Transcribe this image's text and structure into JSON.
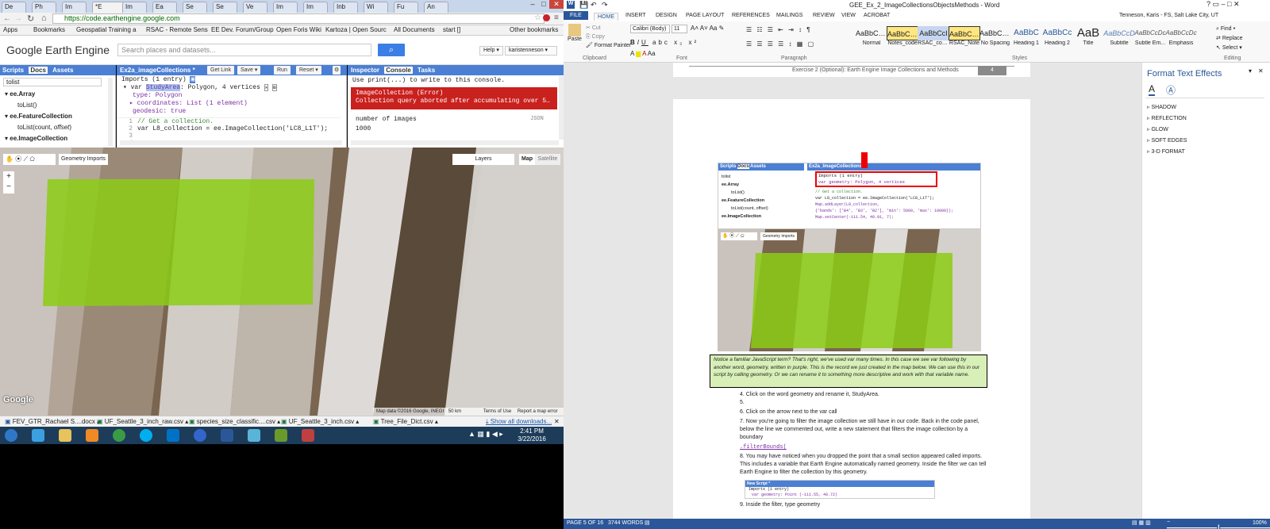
{
  "browser": {
    "tabs": [
      "De",
      "Ph",
      "Im",
      "*E",
      "Im",
      "Ea",
      "Se",
      "Se",
      "Ve",
      "Im",
      "Im",
      "Inb",
      "Wi",
      "Fu",
      "An"
    ],
    "active_tab_label": "*E",
    "url": "https://code.earthengine.google.com",
    "bookmarks": [
      "Apps",
      "Bookmarks",
      "Geospatial Training a",
      "RSAC - Remote Sens",
      "EE Dev. Forum/Group",
      "Open Foris Wiki",
      "Kartoza | Open Sourc",
      "All Documents",
      "start []",
      "Other bookmarks"
    ]
  },
  "ee": {
    "logo": "Google Earth Engine",
    "search_placeholder": "Search places and datasets...",
    "help": "Help",
    "user": "karistenneson",
    "left_tabs": [
      "Scripts",
      "Docs",
      "Assets"
    ],
    "docs_search": "tolist",
    "docs_items": [
      {
        "text": "ee.Array",
        "bold": true
      },
      {
        "text": "toList()",
        "bold": false
      },
      {
        "text": "ee.FeatureCollection",
        "bold": true
      },
      {
        "text": "toList(count, offset)",
        "bold": false
      },
      {
        "text": "ee.ImageCollection",
        "bold": true
      }
    ],
    "script_title": "Ex2a_imageCollections *",
    "get_link": "Get Link",
    "save": "Save",
    "run": "Run",
    "reset": "Reset",
    "imports_header": "Imports (1 entry)",
    "var_line": {
      "kw": "var",
      "name": "StudyArea",
      "rest": ": Polygon, 4 vertices"
    },
    "type_line": "type: Polygon",
    "coords_line": "coordinates: List (1 element)",
    "geodesic_line": "geodesic: true",
    "code_lines": [
      {
        "n": "1",
        "text": "// Get a collection."
      },
      {
        "n": "2",
        "text": "var L8_collection = ee.ImageCollection('LC8_L1T');"
      },
      {
        "n": "3",
        "text": ""
      },
      {
        "n": "4",
        "text": ""
      }
    ],
    "right_tabs": [
      "Inspector",
      "Console",
      "Tasks"
    ],
    "console_hint": "Use print(...) to write to this console.",
    "error_title": "ImageCollection (Error)",
    "error_msg": "Collection query aborted after accumulating over 5000 el",
    "num_images_label": "number of images",
    "num_images_value": "1000",
    "json_label": "JSON",
    "geometry_imports": "Geometry Imports",
    "layers": "Layers",
    "map_btn": "Map",
    "satellite_btn": "Satellite",
    "map_attrib": "Map data ©2016 Google, INEGI",
    "scale": "50 km",
    "terms": "Terms of Use",
    "report": "Report a map error"
  },
  "downloads": [
    "FEV_GTR_Rachael S....docx",
    "UF_Seattle_3_inch_raw.csv",
    "species_size_classific....csv",
    "UF_Seattle_3_inch.csv",
    "Tree_File_Dict.csv"
  ],
  "show_all": "Show all downloads...",
  "taskbar": {
    "time": "2:41 PM",
    "date": "3/22/2016"
  },
  "word": {
    "title": "GEE_Ex_2_ImageCollectionsObjectsMethods - Word",
    "tabs": [
      "FILE",
      "HOME",
      "INSERT",
      "DESIGN",
      "PAGE LAYOUT",
      "REFERENCES",
      "MAILINGS",
      "REVIEW",
      "VIEW",
      "ACROBAT"
    ],
    "user": "Tenneson, Karis - FS, Salt Lake City, UT",
    "clipboard": {
      "paste": "Paste",
      "cut": "Cut",
      "copy": "Copy",
      "format_painter": "Format Painter",
      "label": "Clipboard"
    },
    "font": {
      "name": "Calibri (Body)",
      "size": "11",
      "label": "Font"
    },
    "paragraph_label": "Paragraph",
    "styles_label": "Styles",
    "editing_label": "Editing",
    "styles": [
      {
        "preview": "AaBbCcDc",
        "name": "Normal"
      },
      {
        "preview": "AaBbCcD",
        "name": "Notes_code"
      },
      {
        "preview": "AaBbCcI",
        "name": "RSAC_con..."
      },
      {
        "preview": "AaBbCcD",
        "name": "RSAC_Note"
      },
      {
        "preview": "AaBbCcDc",
        "name": "No Spacing"
      },
      {
        "preview": "AaBbC",
        "name": "Heading 1"
      },
      {
        "preview": "AaBbCc",
        "name": "Heading 2"
      },
      {
        "preview": "AaB",
        "name": "Title"
      },
      {
        "preview": "AaBbCcD",
        "name": "Subtitle"
      },
      {
        "preview": "AaBbCcDc",
        "name": "Subtle Em..."
      },
      {
        "preview": "AaBbCcDc",
        "name": "Emphasis"
      }
    ],
    "editing": [
      "Find",
      "Replace",
      "Select"
    ],
    "footer_text": "Exercise 2 (Optional): Earth Engine Image Collections and Methods",
    "page_num": "4",
    "embedded": {
      "tabs": [
        "Scripts",
        "Docs",
        "Assets"
      ],
      "title": "Ex2a_ImageCollections *",
      "imports": "Imports (1 entry)",
      "var_geom": "var geometry: Polygon, 4 vertices",
      "code": [
        "// Get a collection.",
        "var L8_collection = ee.ImageCollection('LC8_L1T');",
        "",
        "Map.addLayer(L8_collection,",
        "  {'bands': ['B4', 'B3', 'B2'], 'min': 5000, 'max': 10000});",
        "Map.setCenter(-111.54, 40.91, 7);"
      ],
      "geometry_imports": "Geometry Imports",
      "docs": [
        "tolist",
        "ee.Array",
        "toList()",
        "ee.FeatureCollection",
        "toList(count, offset)",
        "ee.ImageCollection"
      ]
    },
    "note": "Notice a familiar JavaScript term? That's right, we've used var many times. In this case we see var following by another word, geometry, written in purple. This is the record we just created in the map below. We can use this in our script by calling geometry. Or we can rename it to something more descriptive and work with that variable name.",
    "list": [
      {
        "n": "4.",
        "text": "Click on the word geometry and rename it, StudyArea."
      },
      {
        "n": "5.",
        "text": ""
      },
      {
        "n": "6.",
        "text": "Click on the arrow next to the var call"
      },
      {
        "n": "7.",
        "text": "Now you're going to filter the image collection we still have in our code. Back in the code panel, below the line we commented out, write a new statement that filters the image collection by a boundary"
      },
      {
        "n": "",
        "text": ".filterBounds("
      },
      {
        "n": "8.",
        "text": "You may have noticed when you dropped the point that a small section appeared called imports. This includes a variable that Earth Engine automatically named geometry. Inside the filter we can tell Earth Engine to filter the collection by this geometry."
      },
      {
        "n": "9.",
        "text": "Inside the filter, type geometry"
      }
    ],
    "mini_script": {
      "title": "New Script *",
      "imports": "Imports (1 entry)",
      "var": "var geometry: Point (-111.55, 40.72)"
    },
    "fte": {
      "title": "Format Text Effects",
      "items": [
        "SHADOW",
        "REFLECTION",
        "GLOW",
        "SOFT EDGES",
        "3-D FORMAT"
      ]
    },
    "status": {
      "page": "PAGE 5 OF 16",
      "words": "3744 WORDS",
      "zoom": "100%"
    }
  }
}
